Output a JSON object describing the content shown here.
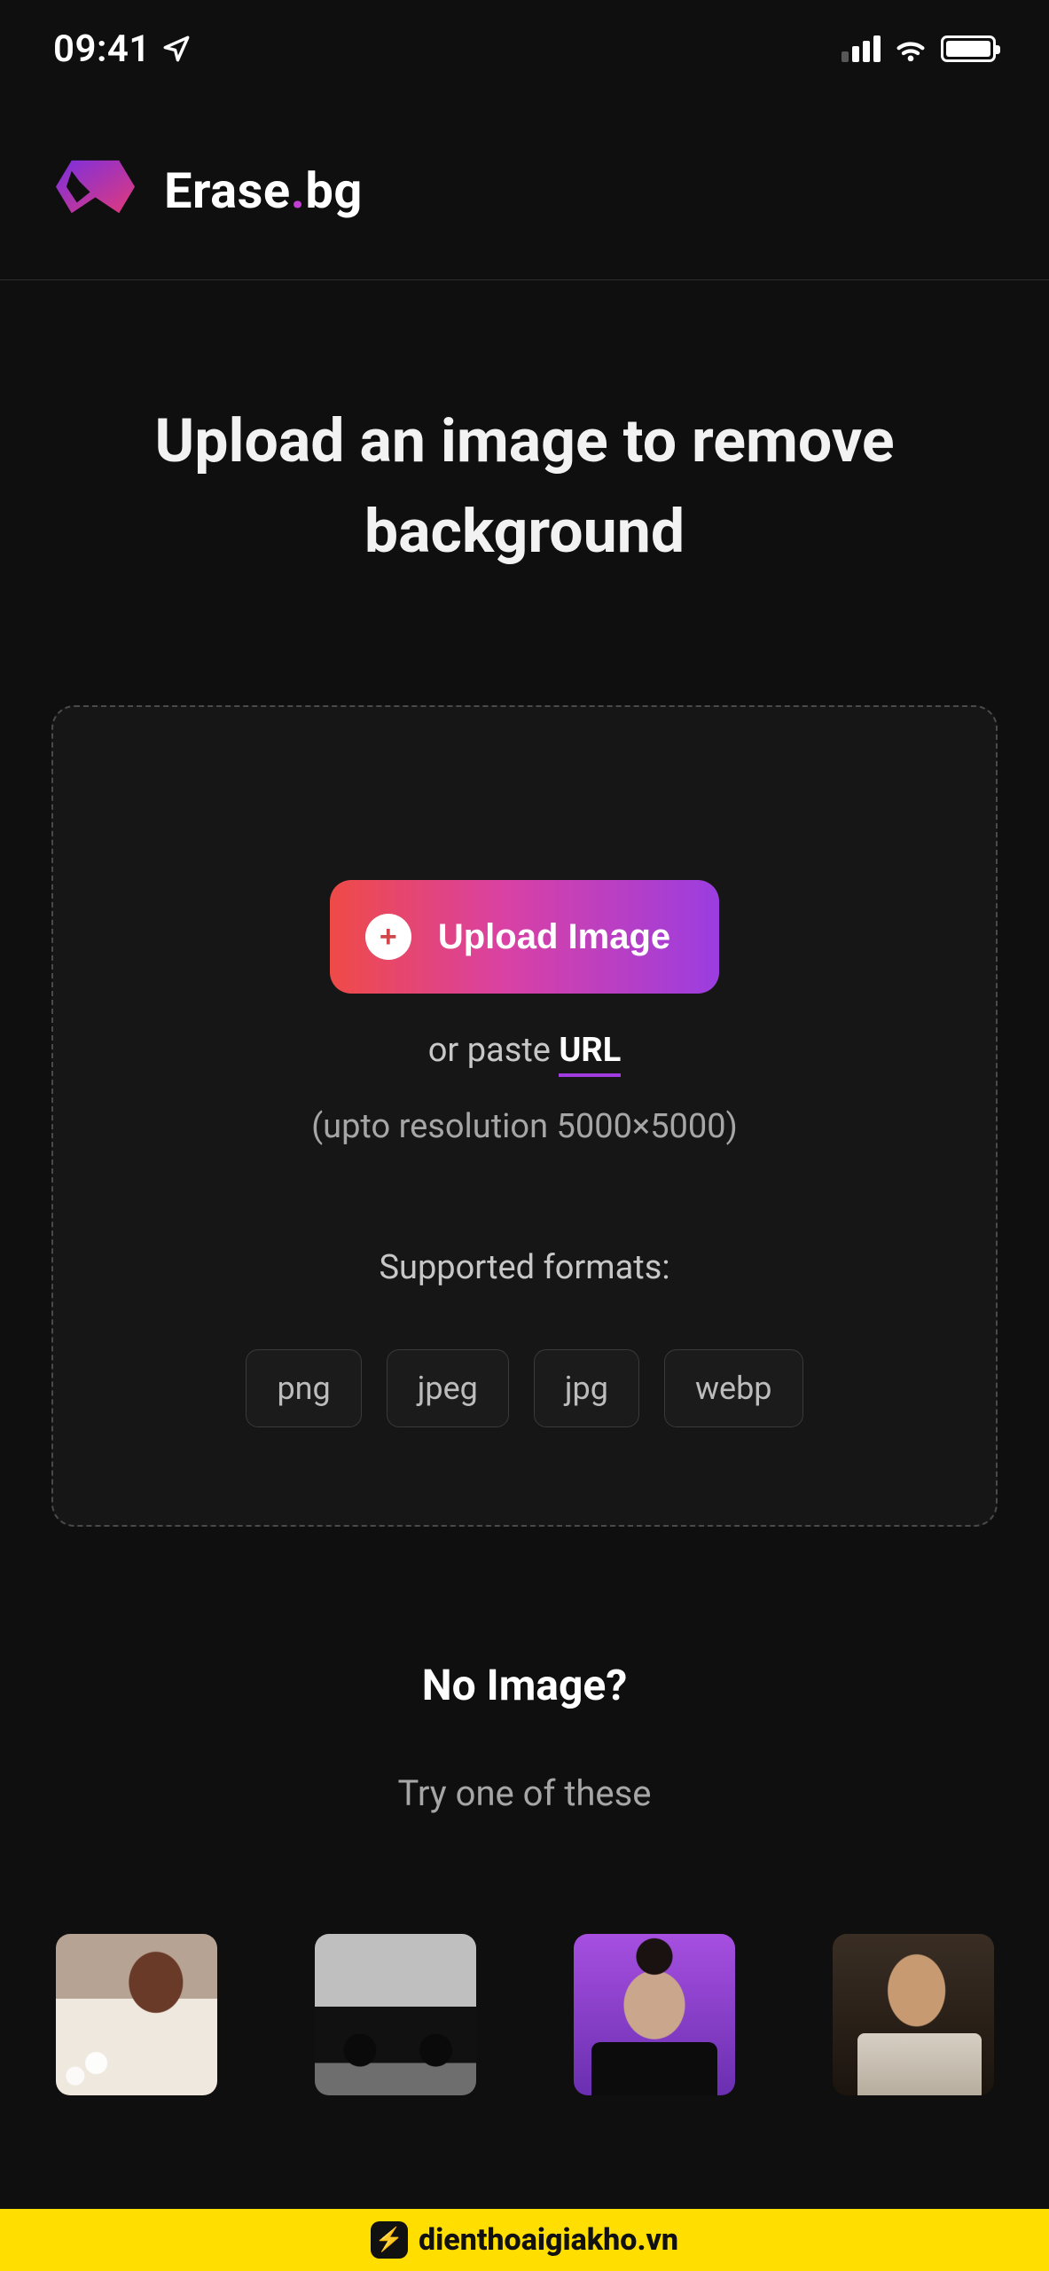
{
  "status": {
    "time": "09:41"
  },
  "header": {
    "brand_main": "Erase",
    "brand_dot": ".",
    "brand_suffix": "bg"
  },
  "hero": {
    "title": "Upload an image to remove background"
  },
  "upload": {
    "button_label": "Upload Image",
    "paste_prefix": "or paste ",
    "paste_link": "URL",
    "resolution": "(upto resolution 5000×5000)",
    "formats_label": "Supported formats:",
    "formats": [
      "png",
      "jpeg",
      "jpg",
      "webp"
    ]
  },
  "noimage": {
    "title": "No Image?",
    "subtitle": "Try one of these"
  },
  "samples": [
    {
      "alt": "Woman in white blazer, bokeh background"
    },
    {
      "alt": "Dark muscle car side view"
    },
    {
      "alt": "Woman with hair bun on purple background"
    },
    {
      "alt": "Man with glasses, warm studio lighting"
    }
  ],
  "watermark": {
    "text": "dienthoaigiakho.vn"
  }
}
